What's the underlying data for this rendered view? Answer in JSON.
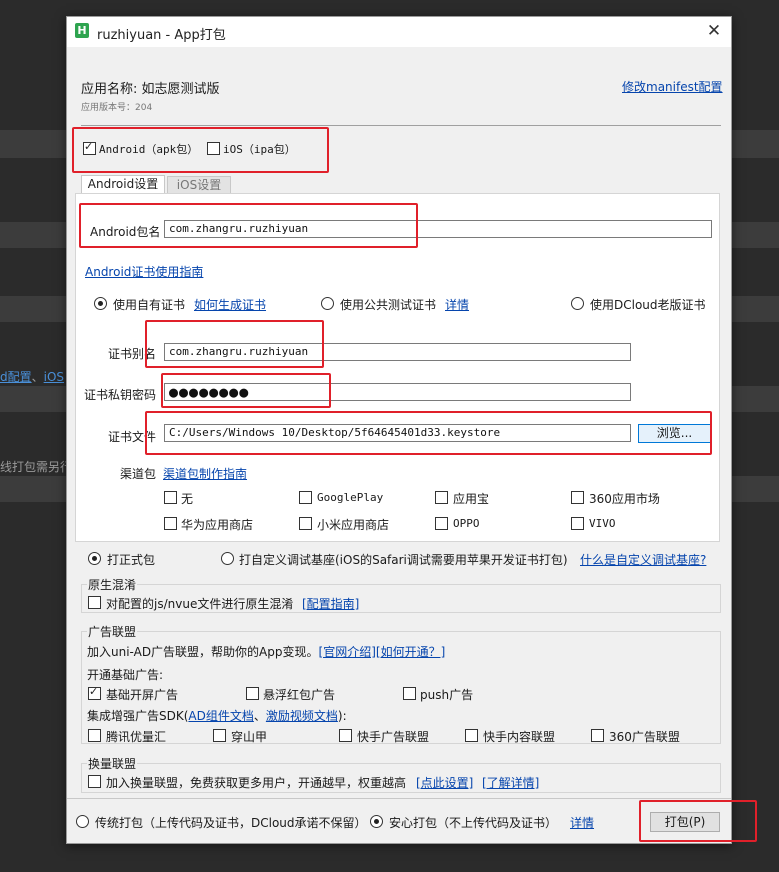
{
  "background": {
    "link1": "d配置",
    "link1_sep": "、",
    "link2": "iOS",
    "text1": "线打包需另行"
  },
  "dialog": {
    "title": "ruzhiyuan - App打包",
    "app_icon_letter": "H",
    "app_name_label": "应用名称:",
    "app_name": "如志愿测试版",
    "version_label": "应用版本号：",
    "version": "204",
    "modify_manifest_link": "修改manifest配置",
    "platforms": {
      "android": {
        "label": "Android（apk包）",
        "checked": true
      },
      "ios": {
        "label": "iOS（ipa包）",
        "checked": false
      }
    },
    "tabs": [
      {
        "label": "Android设置",
        "active": true
      },
      {
        "label": "iOS设置",
        "active": false
      }
    ],
    "android": {
      "package_label": "Android包名",
      "package_value": "com.zhangru.ruzhiyuan",
      "cert_guide_link": "Android证书使用指南",
      "cert_options": [
        {
          "label": "使用自有证书",
          "selected": true
        },
        {
          "label": "使用公共测试证书",
          "selected": false
        },
        {
          "label": "使用DCloud老版证书",
          "selected": false
        }
      ],
      "how_to_generate_link": "如何生成证书",
      "details_link": "详情",
      "alias_label": "证书别名",
      "alias_value": "com.zhangru.ruzhiyuan",
      "password_label": "证书私钥密码",
      "password_value": "●●●●●●●●",
      "cert_file_label": "证书文件",
      "cert_file_value": "C:/Users/Windows 10/Desktop/5f64645401d33.keystore",
      "browse_button": "浏览...",
      "channel_label": "渠道包",
      "channel_guide_link": "渠道包制作指南",
      "channels": [
        {
          "label": "无",
          "checked": false
        },
        {
          "label": "GooglePlay",
          "checked": false
        },
        {
          "label": "应用宝",
          "checked": false
        },
        {
          "label": "360应用市场",
          "checked": false
        },
        {
          "label": "华为应用商店",
          "checked": false
        },
        {
          "label": "小米应用商店",
          "checked": false
        },
        {
          "label": "OPPO",
          "checked": false
        },
        {
          "label": "VIVO",
          "checked": false
        }
      ]
    },
    "build_type": {
      "formal": {
        "label": "打正式包",
        "selected": true
      },
      "custom": {
        "label": "打自定义调试基座(iOS的Safari调试需要用苹果开发证书打包)",
        "selected": false
      },
      "what_is_custom_link": "什么是自定义调试基座?"
    },
    "obfuscation": {
      "group_label": "原生混淆",
      "checkbox_label": "对配置的js/nvue文件进行原生混淆",
      "checked": false,
      "guide_link": "[配置指南]"
    },
    "ad": {
      "group_label": "广告联盟",
      "intro": "加入uni-AD广告联盟，帮助你的App变现。",
      "intro_link1": "[官网介绍]",
      "intro_link2": "[如何开通？]",
      "basic_label": "开通基础广告:",
      "basic_items": [
        {
          "label": "基础开屏广告",
          "checked": true
        },
        {
          "label": "悬浮红包广告",
          "checked": false
        },
        {
          "label": "push广告",
          "checked": false
        }
      ],
      "enhanced_prefix": "集成增强广告SDK(",
      "enhanced_link1": "AD组件文档",
      "enhanced_sep": "、",
      "enhanced_link2": "激励视频文档",
      "enhanced_suffix": "):",
      "enhanced_items": [
        {
          "label": "腾讯优量汇",
          "checked": false
        },
        {
          "label": "穿山甲",
          "checked": false
        },
        {
          "label": "快手广告联盟",
          "checked": false
        },
        {
          "label": "快手内容联盟",
          "checked": false
        },
        {
          "label": "360广告联盟",
          "checked": false
        }
      ]
    },
    "exchange": {
      "group_label": "换量联盟",
      "checkbox_label": "加入换量联盟，免费获取更多用户，开通越早，权重越高",
      "checked": false,
      "link1": "[点此设置]",
      "link2": "[了解详情]"
    },
    "pack_mode": {
      "traditional": {
        "label": "传统打包（上传代码及证书，DCloud承诺不保留）",
        "selected": false
      },
      "safe": {
        "label": "安心打包（不上传代码及证书）",
        "selected": true
      },
      "details_link": "详情"
    },
    "pack_button": "打包(P)"
  }
}
